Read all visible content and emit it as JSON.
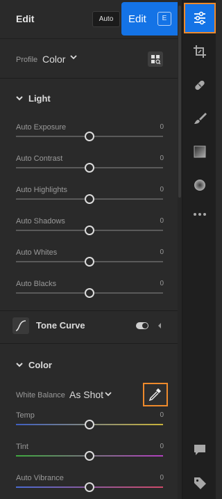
{
  "header": {
    "title": "Edit",
    "auto_label": "Auto"
  },
  "tooltip": {
    "label": "Edit",
    "shortcut": "E"
  },
  "profile": {
    "label": "Profile",
    "value": "Color"
  },
  "light": {
    "title": "Light",
    "sliders": [
      {
        "label": "Auto Exposure",
        "value": "0",
        "position": 0.5
      },
      {
        "label": "Auto Contrast",
        "value": "0",
        "position": 0.5
      },
      {
        "label": "Auto Highlights",
        "value": "0",
        "position": 0.5
      },
      {
        "label": "Auto Shadows",
        "value": "0",
        "position": 0.5
      },
      {
        "label": "Auto Whites",
        "value": "0",
        "position": 0.5
      },
      {
        "label": "Auto Blacks",
        "value": "0",
        "position": 0.5
      }
    ]
  },
  "tone_curve": {
    "title": "Tone Curve",
    "enabled": true
  },
  "color": {
    "title": "Color",
    "white_balance": {
      "label": "White Balance",
      "value": "As Shot"
    },
    "sliders": [
      {
        "label": "Temp",
        "value": "0",
        "position": 0.5,
        "track_colors": [
          "#3f5fc0",
          "#c9b33a"
        ]
      },
      {
        "label": "Tint",
        "value": "0",
        "position": 0.5,
        "track_colors": [
          "#3fa83f",
          "#b23fbf"
        ]
      },
      {
        "label": "Auto Vibrance",
        "value": "0",
        "position": 0.5,
        "track_colors": [
          "#4a6ad0",
          "#d04a6a"
        ]
      }
    ]
  },
  "rail": {
    "items": [
      {
        "name": "edit-icon",
        "active": true
      },
      {
        "name": "crop-icon"
      },
      {
        "name": "healing-icon"
      },
      {
        "name": "brush-icon"
      },
      {
        "name": "linear-gradient-icon"
      },
      {
        "name": "radial-gradient-icon"
      },
      {
        "name": "more-icon"
      }
    ],
    "bottom_items": [
      {
        "name": "comment-icon"
      },
      {
        "name": "tag-icon"
      }
    ]
  },
  "colors": {
    "accent_blue": "#1473e6",
    "highlight_orange": "#ee8a2c"
  }
}
